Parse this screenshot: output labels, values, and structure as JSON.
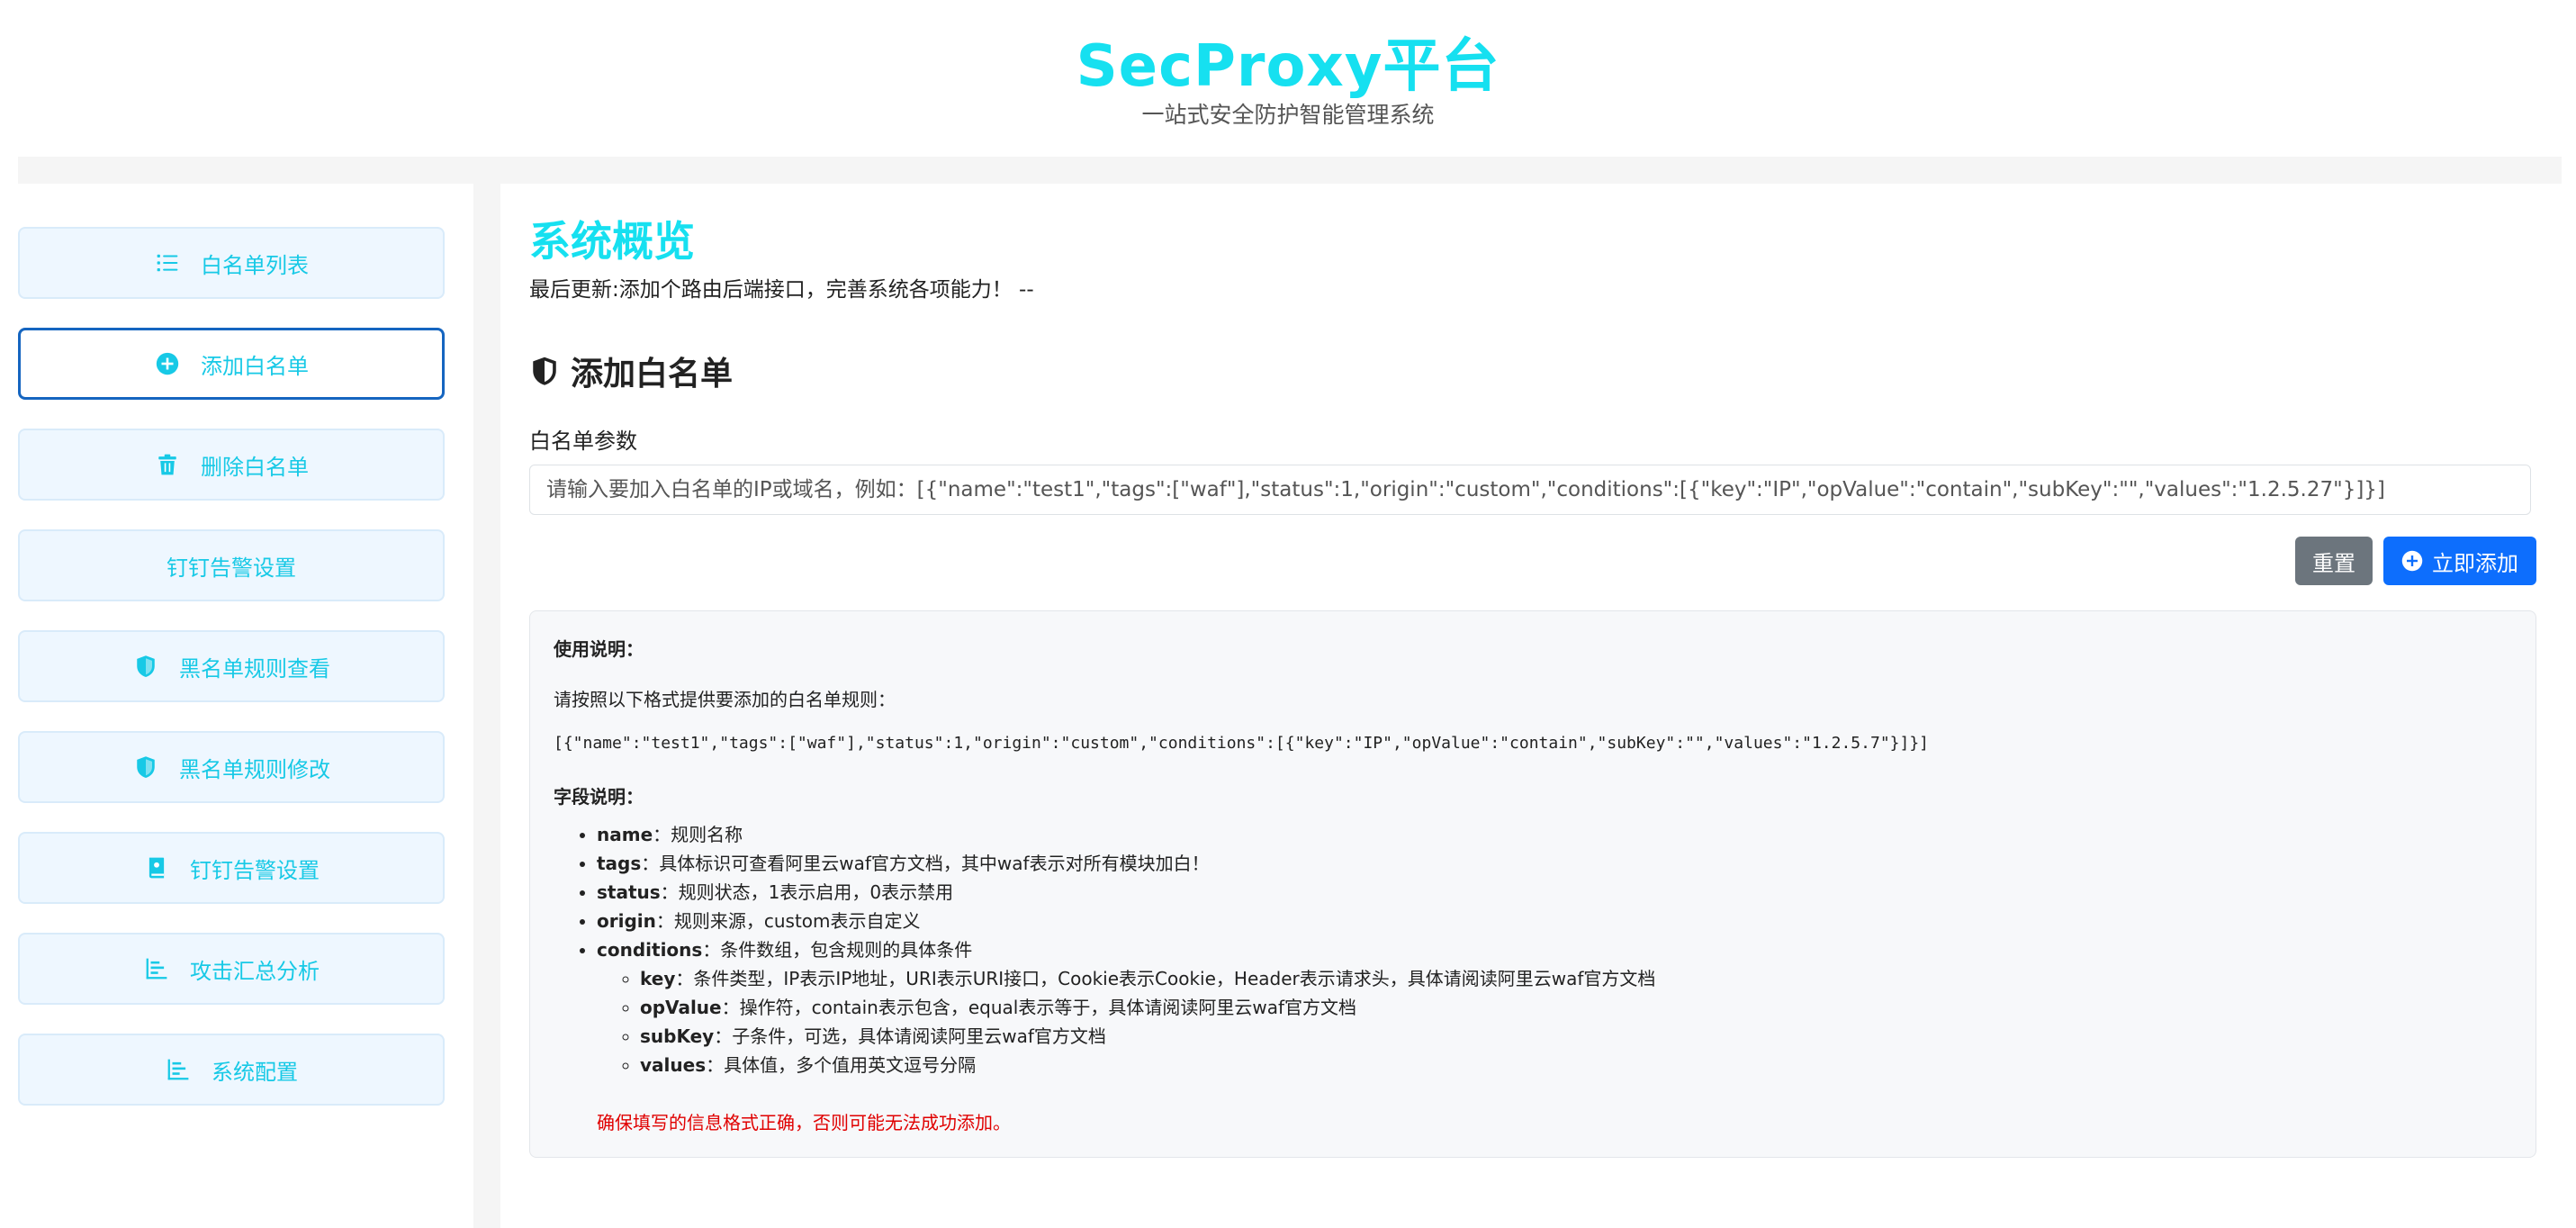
{
  "header": {
    "brand": "SecProxy平台",
    "slogan": "一站式安全防护智能管理系统"
  },
  "sidebar": {
    "items": [
      {
        "label": "白名单列表",
        "icon": "list-icon"
      },
      {
        "label": "添加白名单",
        "icon": "plus-circle-icon",
        "active": true
      },
      {
        "label": "删除白名单",
        "icon": "trash-icon"
      },
      {
        "label": "钉钉告警设置",
        "icon": ""
      },
      {
        "label": "黑名单规则查看",
        "icon": "shield-icon"
      },
      {
        "label": "黑名单规则修改",
        "icon": "shield-icon"
      },
      {
        "label": "钉钉告警设置",
        "icon": "book-icon"
      },
      {
        "label": "攻击汇总分析",
        "icon": "bar-chart-icon"
      },
      {
        "label": "系统配置",
        "icon": "bar-chart-icon"
      }
    ]
  },
  "main": {
    "title": "系统概览",
    "update": "最后更新:添加个路由后端接口，完善系统各项能力！ --",
    "section_title": "添加白名单",
    "field_label": "白名单参数",
    "input_placeholder": "请输入要加入白名单的IP或域名，例如：[{\"name\":\"test1\",\"tags\":[\"waf\"],\"status\":1,\"origin\":\"custom\",\"conditions\":[{\"key\":\"IP\",\"opValue\":\"contain\",\"subKey\":\"\",\"values\":\"1.2.5.27\"}]}]",
    "input_value": "",
    "reset_label": "重置",
    "add_label": "立即添加"
  },
  "help": {
    "usage_title": "使用说明：",
    "intro": "请按照以下格式提供要添加的白名单规则：",
    "example": "[{\"name\":\"test1\",\"tags\":[\"waf\"],\"status\":1,\"origin\":\"custom\",\"conditions\":[{\"key\":\"IP\",\"opValue\":\"contain\",\"subKey\":\"\",\"values\":\"1.2.5.7\"}]}]",
    "fields_title": "字段说明：",
    "fields": [
      {
        "key": "name",
        "desc": "：规则名称"
      },
      {
        "key": "tags",
        "desc": "：具体标识可查看阿里云waf官方文档，其中waf表示对所有模块加白！"
      },
      {
        "key": "status",
        "desc": "：规则状态，1表示启用，0表示禁用"
      },
      {
        "key": "origin",
        "desc": "：规则来源，custom表示自定义"
      },
      {
        "key": "conditions",
        "desc": "：条件数组，包含规则的具体条件"
      }
    ],
    "subfields": [
      {
        "key": "key",
        "desc": "：条件类型，IP表示IP地址，URI表示URI接口，Cookie表示Cookie，Header表示请求头，具体请阅读阿里云waf官方文档"
      },
      {
        "key": "opValue",
        "desc": "：操作符，contain表示包含，equal表示等于，具体请阅读阿里云waf官方文档"
      },
      {
        "key": "subKey",
        "desc": "：子条件，可选，具体请阅读阿里云waf官方文档"
      },
      {
        "key": "values",
        "desc": "：具体值，多个值用英文逗号分隔"
      }
    ],
    "warning": "确保填写的信息格式正确，否则可能无法成功添加。"
  },
  "colors": {
    "brand": "#16e0f0",
    "nav_text": "#17c9e6",
    "primary": "#0d6efd",
    "secondary": "#6c757d",
    "warning": "#e00000"
  }
}
